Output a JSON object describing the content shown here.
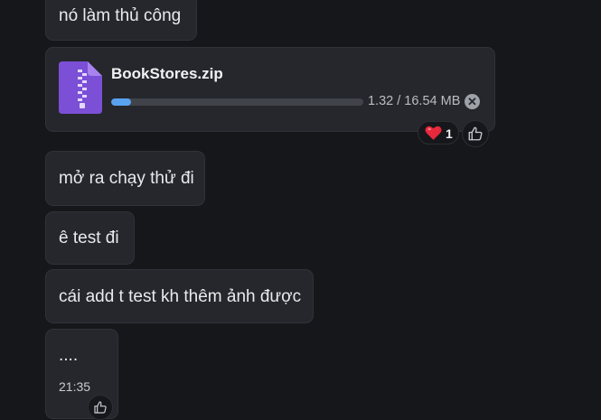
{
  "messages": {
    "m1": "nó làm thủ công",
    "file": {
      "name": "BookStores.zip",
      "progress_text": "1.32 / 16.54 MB",
      "progress_fraction": 0.08,
      "icon": "zip-file-icon",
      "cancel_icon": "close-icon"
    },
    "reaction": {
      "emoji_icon": "heart-icon",
      "count": "1"
    },
    "m2": "mở ra chạy thử đi",
    "m3": "ê test đi",
    "m4": "cái add t test kh thêm ảnh được",
    "m5": "....",
    "m5_time": "21:35"
  },
  "colors": {
    "background": "#16171b",
    "bubble": "#25272c",
    "progress": "#5aa2f0",
    "zip_icon": "#7b4fd6"
  }
}
